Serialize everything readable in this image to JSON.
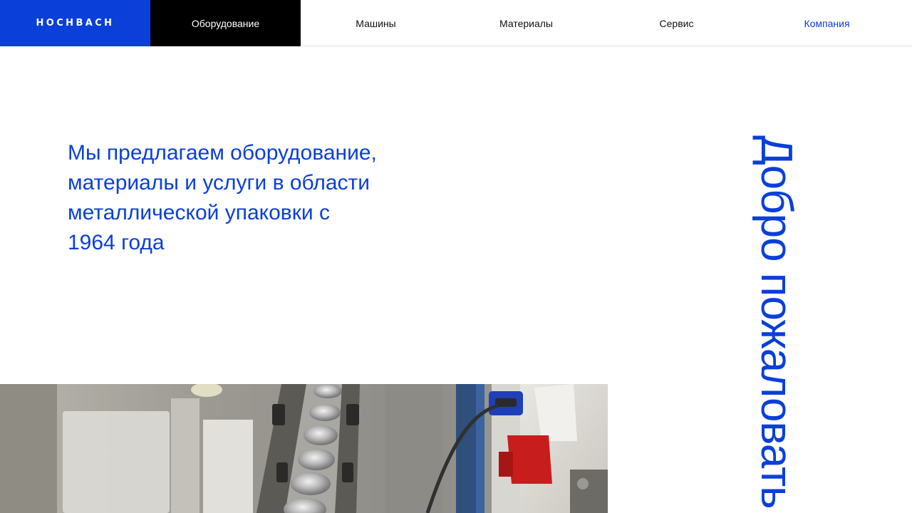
{
  "header": {
    "logo": "HOCHBACH",
    "nav": [
      {
        "label": "Оборудование"
      },
      {
        "label": "Машины"
      },
      {
        "label": "Материалы"
      },
      {
        "label": "Сервис"
      },
      {
        "label": "Компания"
      }
    ],
    "active_index": 0
  },
  "hero": {
    "tagline": "Мы предлагаем оборудование, материалы и услуги в области металлической упаковки с 1964 года",
    "welcome": "Добро пожаловать"
  },
  "colors": {
    "brand_blue": "#0a3fd9",
    "active_nav_bg": "#000000",
    "background": "#ffffff"
  }
}
